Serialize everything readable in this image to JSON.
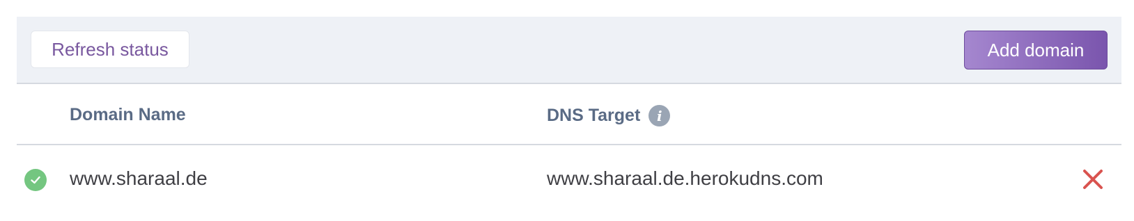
{
  "toolbar": {
    "refresh_label": "Refresh status",
    "add_label": "Add domain"
  },
  "table": {
    "columns": {
      "domain": "Domain Name",
      "dns": "DNS Target",
      "dns_info_icon": "info-icon"
    },
    "rows": [
      {
        "status": "verified",
        "status_icon": "check-circle-icon",
        "domain": "www.sharaal.de",
        "dns_target": "www.sharaal.de.herokudns.com",
        "remove_icon": "close-icon"
      }
    ]
  },
  "colors": {
    "accent": "#79589f",
    "success": "#74c680",
    "danger": "#d9534f",
    "header_text": "#5a6b85"
  }
}
